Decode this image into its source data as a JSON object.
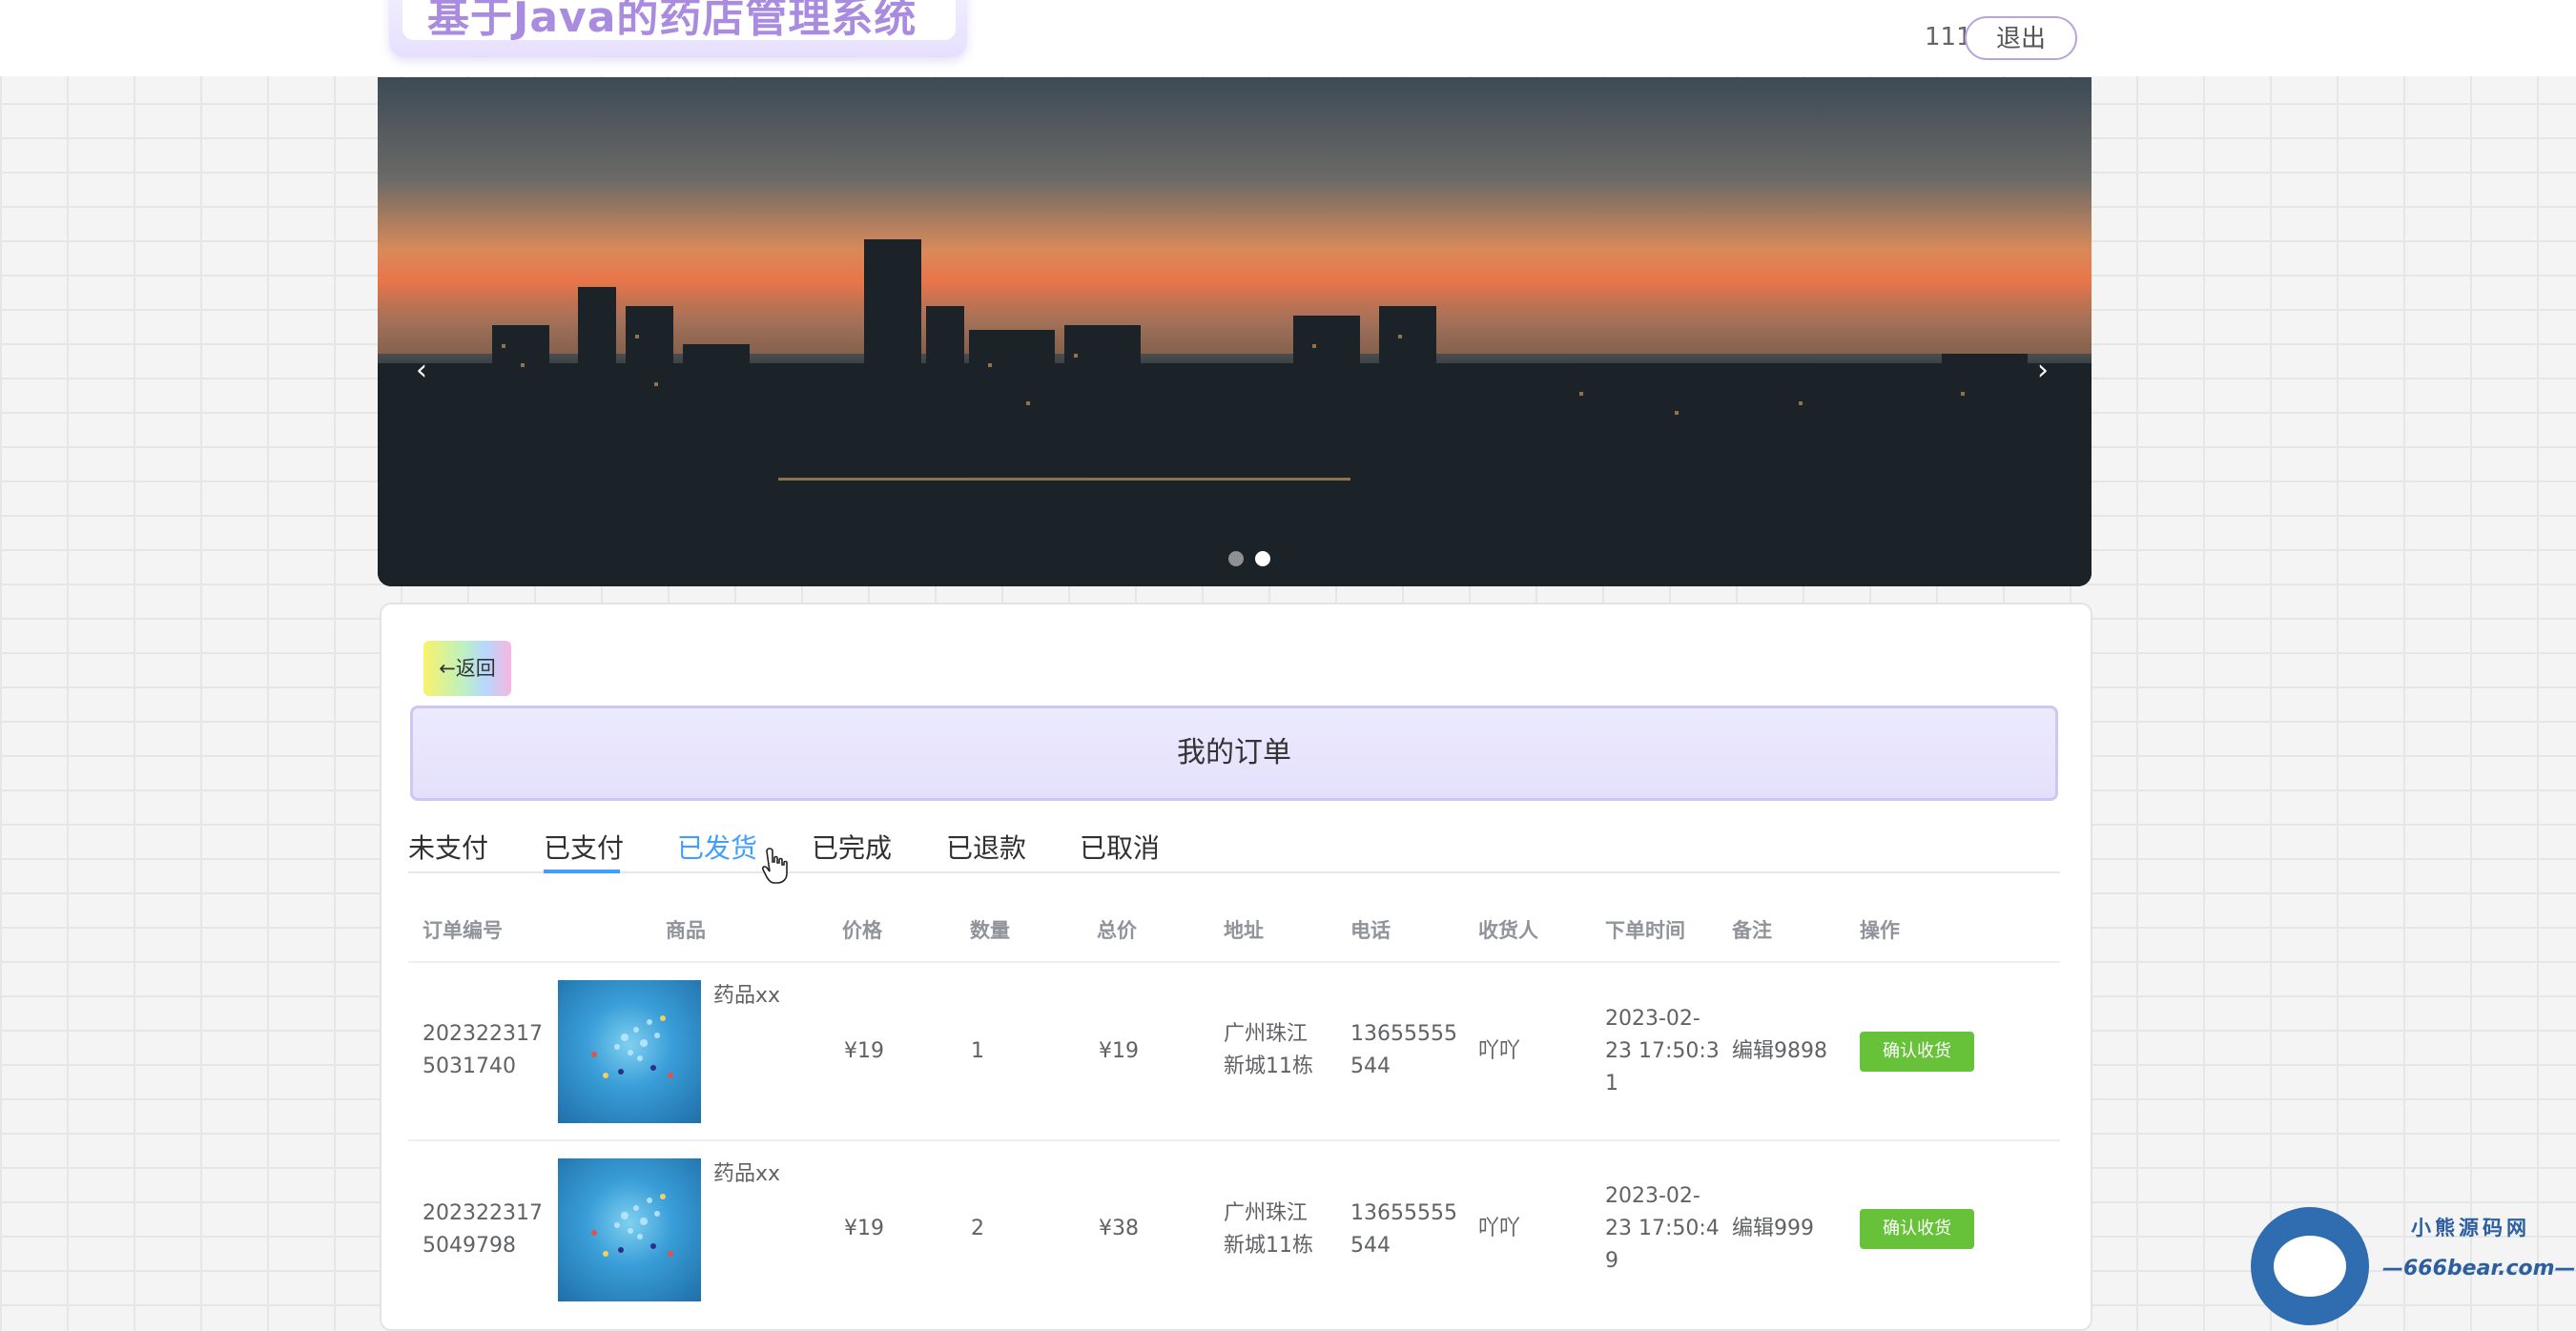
{
  "header": {
    "logo_text": "基于Java的药店管理系统",
    "username": "111",
    "logout_label": "退出"
  },
  "banner": {
    "prev_arrow": "‹",
    "next_arrow": "›",
    "active_slide": 2,
    "slide_count": 2
  },
  "back_button": "←返回",
  "page_title": "我的订单",
  "tabs": [
    "未支付",
    "已支付",
    "已发货",
    "已完成",
    "已退款",
    "已取消"
  ],
  "selected_tab_index": 1,
  "hovered_tab_index": 2,
  "table": {
    "headers": [
      "订单编号",
      "商品",
      "价格",
      "数量",
      "总价",
      "地址",
      "电话",
      "收货人",
      "下单时间",
      "备注",
      "操作"
    ],
    "rows": [
      {
        "order_no": [
          "202322317",
          "5031740"
        ],
        "product": "药品xx",
        "price": "¥19",
        "qty": "1",
        "total": "¥19",
        "address": [
          "广州珠江",
          "新城11栋"
        ],
        "phone": [
          "13655555",
          "544"
        ],
        "receiver": "吖吖",
        "time": [
          "2023-02-",
          "23 17:50:3",
          "1"
        ],
        "remark": "编辑9898",
        "action": "确认收货"
      },
      {
        "order_no": [
          "202322317",
          "5049798"
        ],
        "product": "药品xx",
        "price": "¥19",
        "qty": "2",
        "total": "¥38",
        "address": [
          "广州珠江",
          "新城11栋"
        ],
        "phone": [
          "13655555",
          "544"
        ],
        "receiver": "吖吖",
        "time": [
          "2023-02-",
          "23 17:50:4",
          "9"
        ],
        "remark": "编辑999",
        "action": "确认收货"
      }
    ]
  },
  "watermark": {
    "line1": "小熊源码网",
    "line2": "—666bear.com—"
  },
  "colors": {
    "accent_blue": "#409eff",
    "confirm_green": "#67c23a",
    "logo_purple": "#a98be0"
  }
}
